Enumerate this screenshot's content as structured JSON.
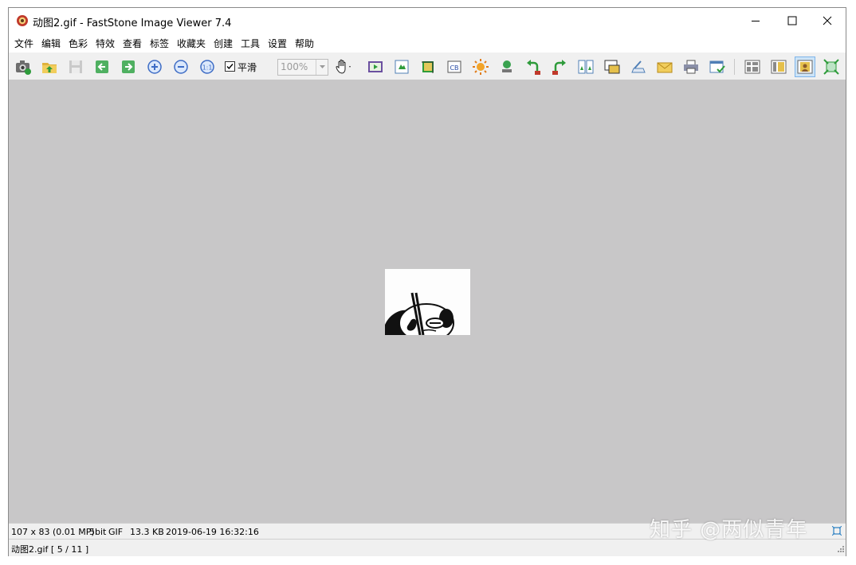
{
  "window": {
    "title": "动图2.gif  -  FastStone Image Viewer 7.4"
  },
  "menu": [
    "文件",
    "编辑",
    "色彩",
    "特效",
    "查看",
    "标签",
    "收藏夹",
    "创建",
    "工具",
    "设置",
    "帮助"
  ],
  "toolbar": {
    "smooth_label": "平滑",
    "smooth_checked": true,
    "zoom_value": "100%",
    "icons": [
      "camera-icon",
      "open-folder-icon",
      "save-icon",
      "previous-icon",
      "next-icon",
      "zoom-in-icon",
      "zoom-out-icon",
      "actual-size-icon",
      "hand-tool-icon",
      "slideshow-icon",
      "resize-icon",
      "crop-icon",
      "color-adjust-icon",
      "brightness-icon",
      "stamp-icon",
      "rotate-left-icon",
      "rotate-right-icon",
      "compare-icon",
      "frame-icon",
      "scanner-icon",
      "email-icon",
      "print-icon",
      "batch-icon",
      "browser-layout-icon",
      "thumbnail-layout-icon",
      "viewer-layout-icon",
      "fullscreen-icon"
    ]
  },
  "status": {
    "dimensions": "107 x 83 (0.01 MP)",
    "bit_depth": "5bit",
    "format": "GIF",
    "file_size": "13.3 KB",
    "datetime": "2019-06-19 16:32:16",
    "file_info": "动图2.gif [ 5 / 11 ]"
  },
  "watermark": "知乎 @两似青年",
  "colors": {
    "canvas_bg": "#c8c7c8",
    "chrome_bg": "#f0f0f0",
    "selected_button": "#cde4f7"
  }
}
